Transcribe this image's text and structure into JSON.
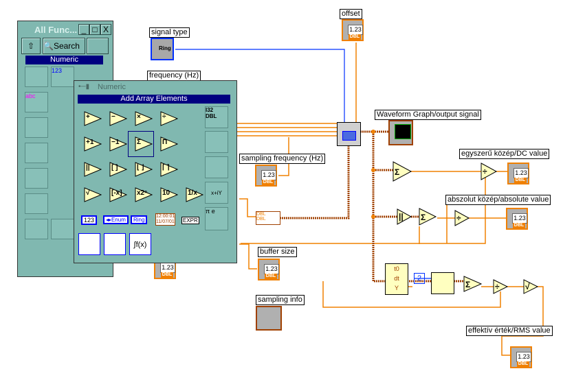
{
  "palette": {
    "title": "All Func...",
    "search_label": "Search",
    "category": "Numeric",
    "buttons": {
      "minimize": "_",
      "maximize": "□",
      "close": "X"
    },
    "tiles": [
      "123",
      "TF",
      "abc",
      "aA",
      "R C 1 2 3 4"
    ]
  },
  "subpalette": {
    "title": "Numeric",
    "selected": "Add Array Elements",
    "ops": [
      "+",
      "−",
      "×",
      "÷",
      "+1",
      "−1",
      "Σ",
      "Π",
      "||",
      "[ ]",
      "⌊ ⌋",
      "⌈ ⌉",
      "√",
      "[-x]",
      "x2ⁿ",
      "10",
      "1/x"
    ],
    "constants": [
      "123",
      "◂▸Enum",
      "Ring",
      "12:00:01\n11/07/01",
      "EXPR"
    ],
    "side": [
      "I32",
      "DBL",
      "x+iY",
      "π",
      "e"
    ],
    "bottom": [
      "f(x)"
    ]
  },
  "diagram": {
    "labels": {
      "offset": "offset",
      "signal_type": "signal type",
      "frequency": "frequency (Hz)",
      "waveform": "Waveform Graph/output signal",
      "sampling_frequency": "sampling frequency  (Hz)",
      "dc": "egyszerű közép/DC value",
      "abs": "abszolut közép/absolute value",
      "buffer": "buffer size",
      "sampling_info": "sampling info",
      "rms": "effektív érték/RMS value"
    },
    "indicator_value": "1.23",
    "indicator_type": "DBL",
    "ring_text": "Ring",
    "constant_two": "2",
    "getter": [
      "t0",
      "dt",
      "Y"
    ],
    "wire_colors": {
      "numeric": "#f08000",
      "enum": "#0030ff",
      "waveform": "#a04000"
    }
  }
}
